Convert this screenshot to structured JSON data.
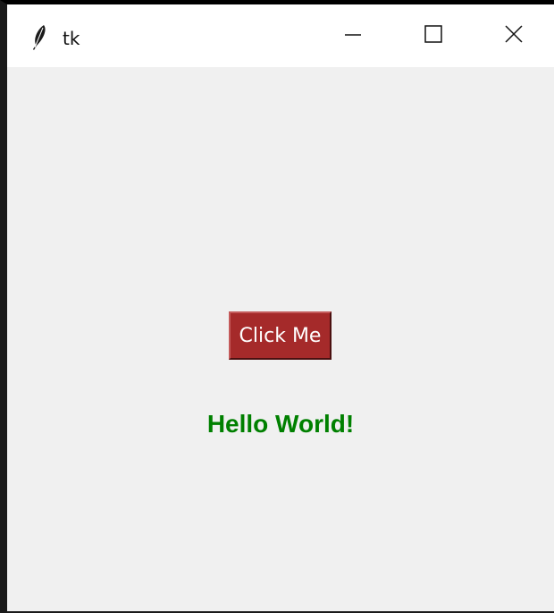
{
  "window": {
    "title": "tk",
    "icon": "feather-icon",
    "controls": {
      "minimize_icon": "minimize-icon",
      "maximize_icon": "maximize-icon",
      "close_icon": "close-icon"
    }
  },
  "content": {
    "button_label": "Click Me",
    "message": "Hello World!"
  },
  "colors": {
    "button_bg": "#a52a2a",
    "button_text": "#ffffff",
    "message_text": "#008000",
    "window_bg": "#f0f0f0"
  }
}
